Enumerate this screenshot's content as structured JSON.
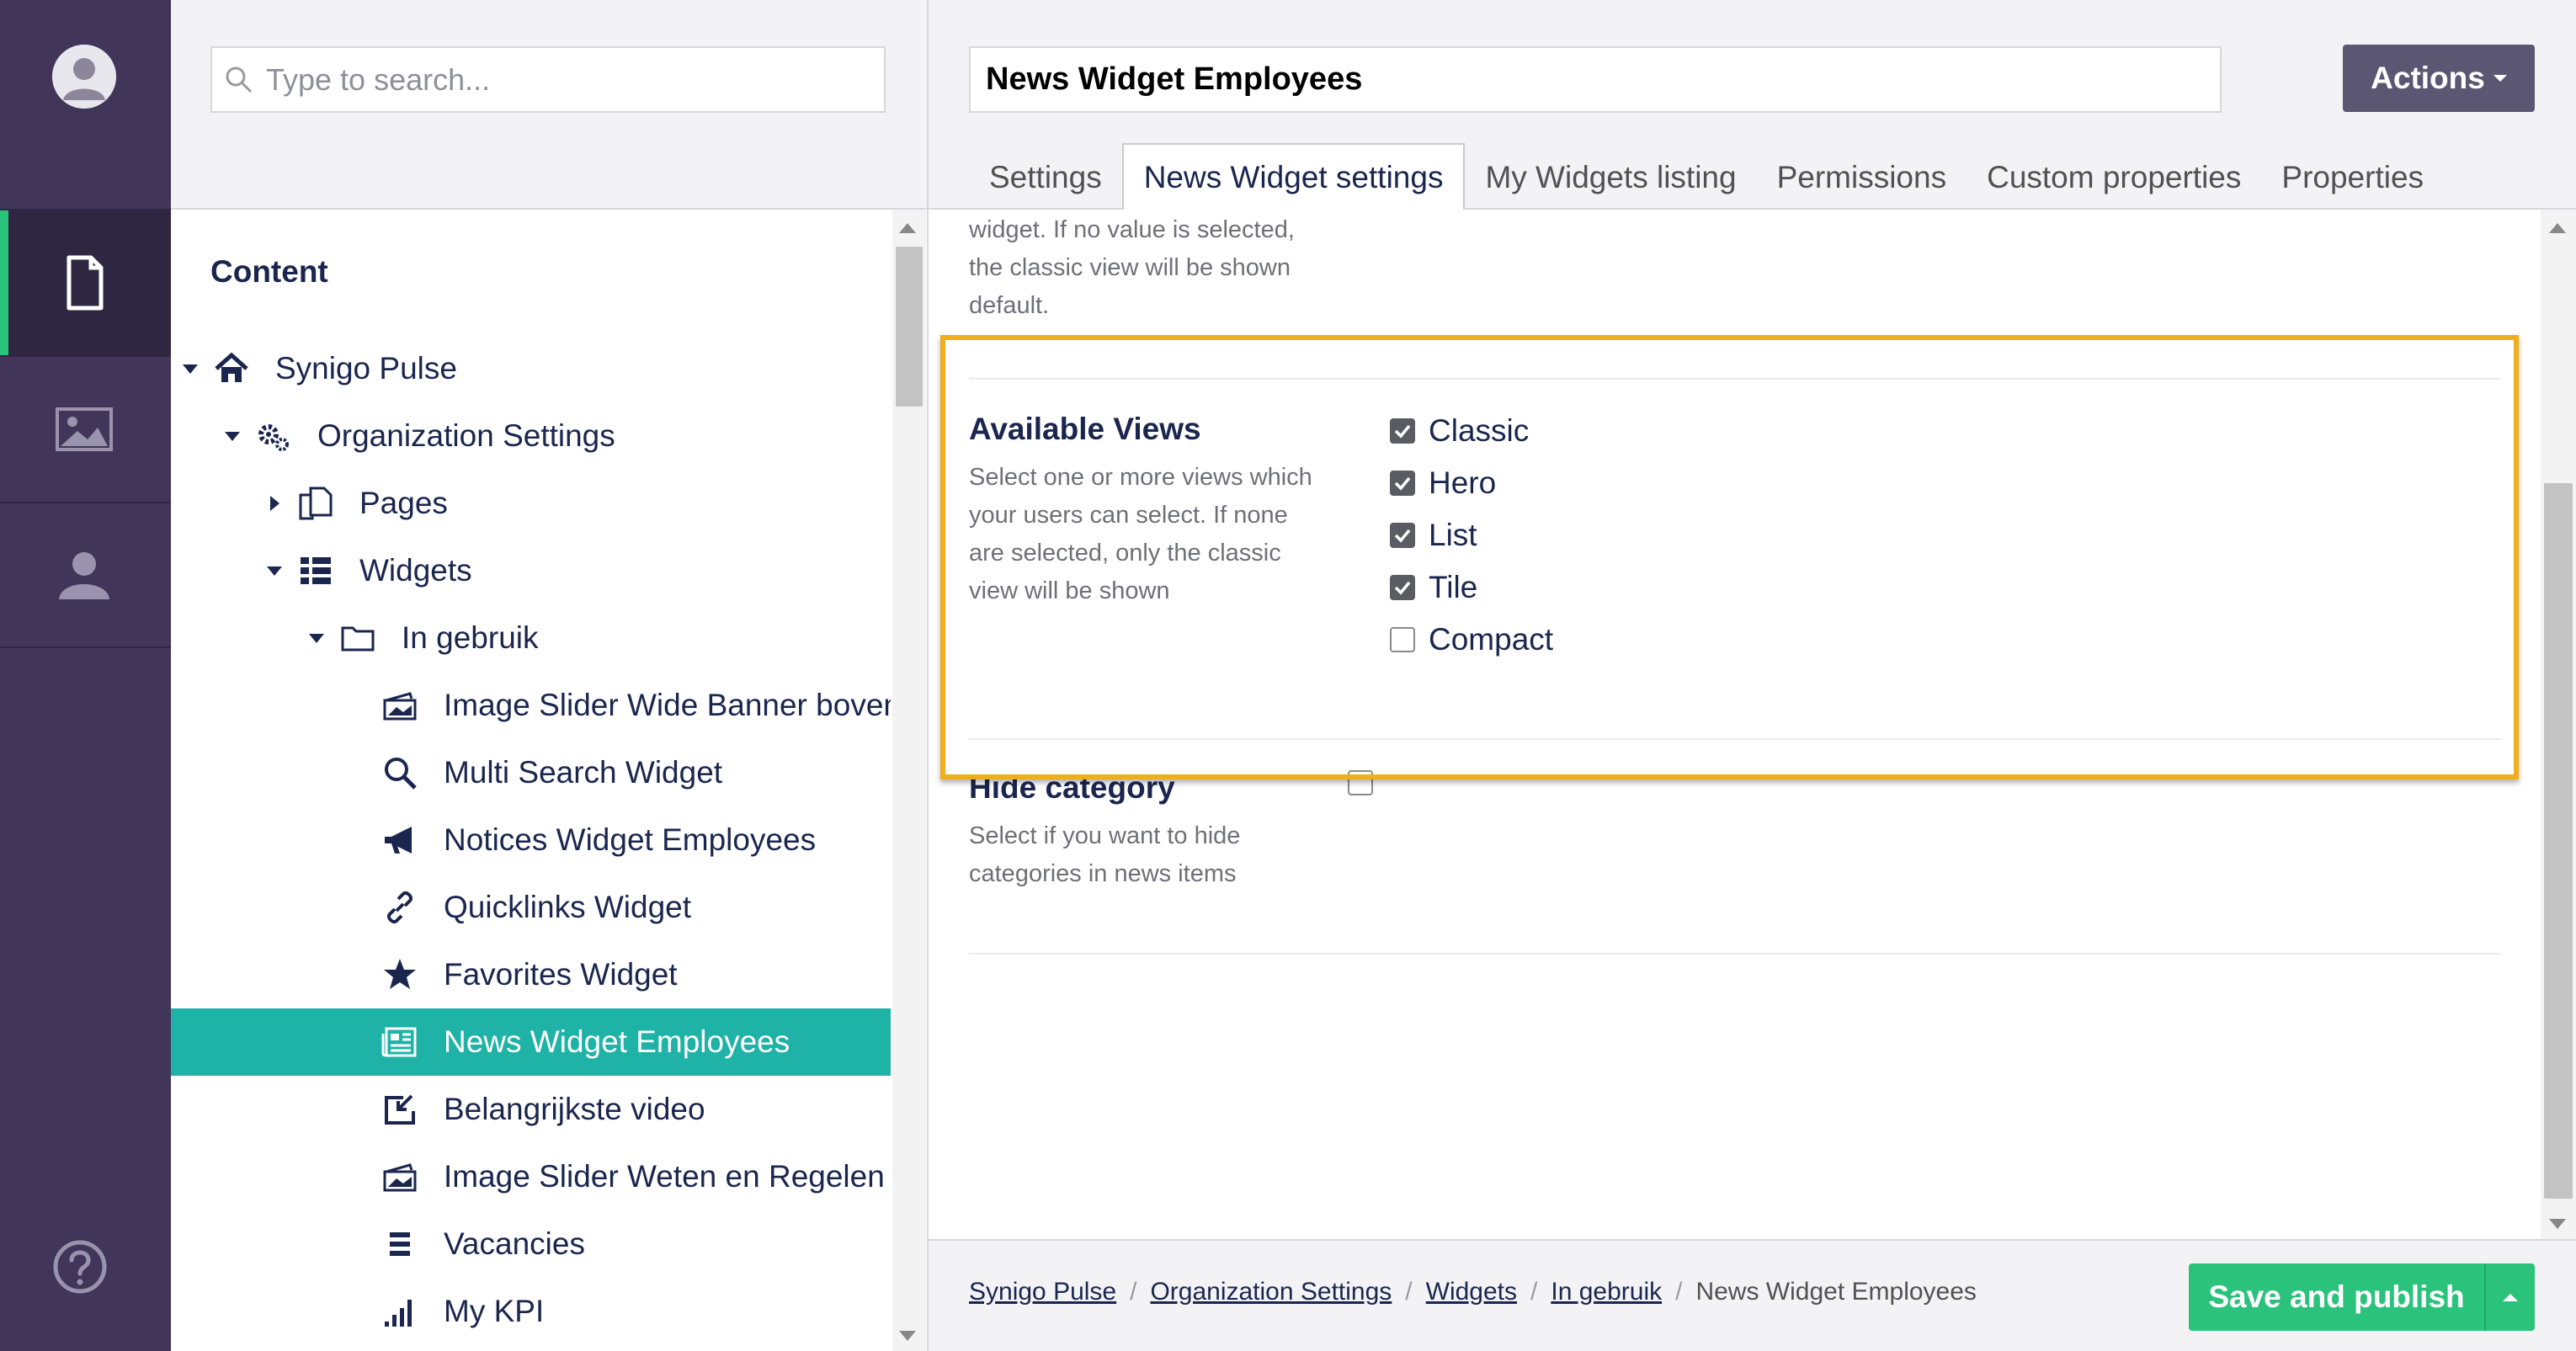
{
  "colors": {
    "rail": "#413659",
    "accent_green": "#2bc37c",
    "selected_row": "#1fb2a6",
    "highlight": "#f0ad1d",
    "actions_button": "#5b5772"
  },
  "search": {
    "placeholder": "Type to search..."
  },
  "tree": {
    "section_title": "Content",
    "items": [
      {
        "label": "Synigo Pulse",
        "icon": "home-icon",
        "expanded": true
      },
      {
        "label": "Organization Settings",
        "icon": "gears-icon",
        "expanded": true
      },
      {
        "label": "Pages",
        "icon": "documents-icon",
        "expanded": false
      },
      {
        "label": "Widgets",
        "icon": "grid-list-icon",
        "expanded": true
      },
      {
        "label": "In gebruik",
        "icon": "folder-icon",
        "expanded": true
      },
      {
        "label": "Image Slider Wide Banner boven",
        "icon": "slides-icon"
      },
      {
        "label": "Multi Search Widget",
        "icon": "search-icon"
      },
      {
        "label": "Notices Widget Employees",
        "icon": "megaphone-icon"
      },
      {
        "label": "Quicklinks Widget",
        "icon": "link-icon"
      },
      {
        "label": "Favorites Widget",
        "icon": "star-icon"
      },
      {
        "label": "News Widget Employees",
        "icon": "newspaper-icon",
        "selected": true
      },
      {
        "label": "Belangrijkste video",
        "icon": "video-embed-icon"
      },
      {
        "label": "Image Slider Weten en Regelen",
        "icon": "slides-icon"
      },
      {
        "label": "Vacancies",
        "icon": "list-icon"
      },
      {
        "label": "My KPI",
        "icon": "bar-chart-icon"
      }
    ]
  },
  "editor": {
    "name": "News Widget Employees",
    "actions_label": "Actions",
    "tabs": [
      "Settings",
      "News Widget settings",
      "My Widgets listing",
      "Permissions",
      "Custom properties",
      "Properties"
    ],
    "active_tab": 1,
    "prev_help": "widget. If no value is selected, the classic view will be shown default.",
    "available_views": {
      "label": "Available Views",
      "description": "Select one or more views which your users can select. If none are selected, only the classic view will be shown",
      "options": [
        {
          "label": "Classic",
          "checked": true
        },
        {
          "label": "Hero",
          "checked": true
        },
        {
          "label": "List",
          "checked": true
        },
        {
          "label": "Tile",
          "checked": true
        },
        {
          "label": "Compact",
          "checked": false
        }
      ]
    },
    "hide_category": {
      "label": "Hide category",
      "description": "Select if you want to hide categories in news items",
      "checked": false
    }
  },
  "footer": {
    "breadcrumb": [
      "Synigo Pulse",
      "Organization Settings",
      "Widgets",
      "In gebruik"
    ],
    "current": "News Widget Employees",
    "save_label": "Save and publish"
  }
}
